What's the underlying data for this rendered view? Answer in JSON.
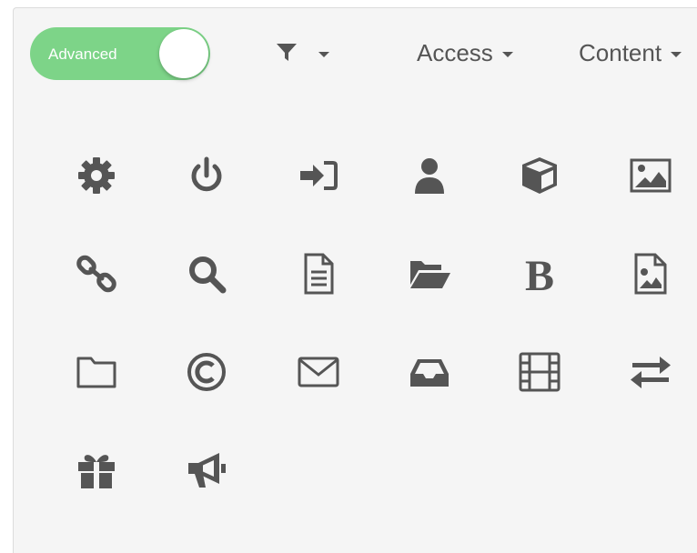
{
  "toggle": {
    "label": "Advanced",
    "on": true,
    "color": "#7dd488"
  },
  "toolbar": {
    "filter_icon": "filter-icon",
    "access_label": "Access",
    "content_label": "Content"
  },
  "icons": [
    "cog-icon",
    "power-icon",
    "sign-in-icon",
    "user-icon",
    "cube-icon",
    "image-icon",
    "link-icon",
    "search-icon",
    "file-text-icon",
    "folder-open-icon",
    "bold-icon",
    "file-image-icon",
    "folder-icon",
    "copyright-icon",
    "envelope-icon",
    "inbox-icon",
    "film-icon",
    "exchange-icon",
    "gift-icon",
    "bullhorn-icon"
  ],
  "colors": {
    "icon": "#555555",
    "panel": "#f5f5f5"
  }
}
